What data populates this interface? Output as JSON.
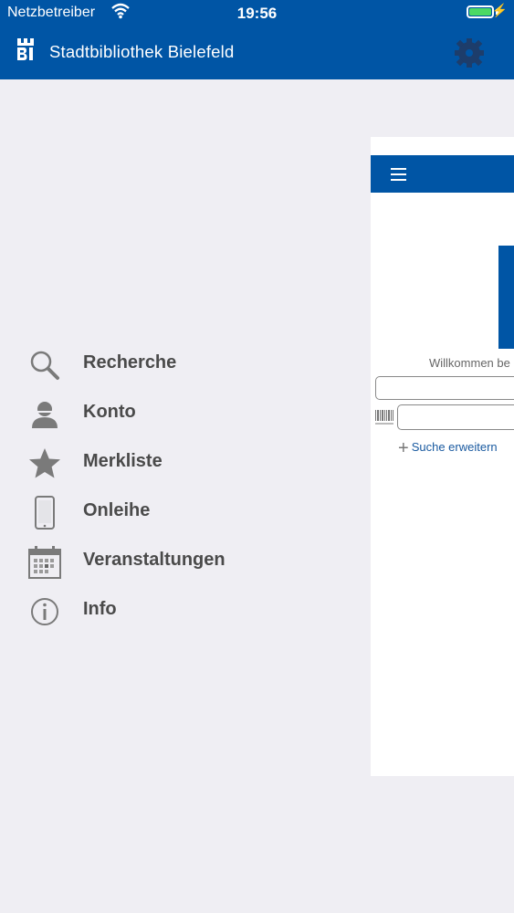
{
  "status": {
    "carrier": "Netzbetreiber",
    "time": "19:56"
  },
  "header": {
    "title": "Stadtbibliothek Bielefeld"
  },
  "menu": [
    {
      "label": "Recherche",
      "icon": "search-icon"
    },
    {
      "label": "Konto",
      "icon": "user-icon"
    },
    {
      "label": "Merkliste",
      "icon": "star-icon"
    },
    {
      "label": "Onleihe",
      "icon": "tablet-icon"
    },
    {
      "label": "Veranstaltungen",
      "icon": "calendar-icon"
    },
    {
      "label": "Info",
      "icon": "info-icon"
    }
  ],
  "preview": {
    "welcome": "Willkommen be",
    "extend_search": "Suche erweitern"
  },
  "colors": {
    "brand": "#0055a5",
    "background": "#efeef3",
    "menu_text": "#4a4a4a",
    "icon_gray": "#7a7a7a"
  }
}
